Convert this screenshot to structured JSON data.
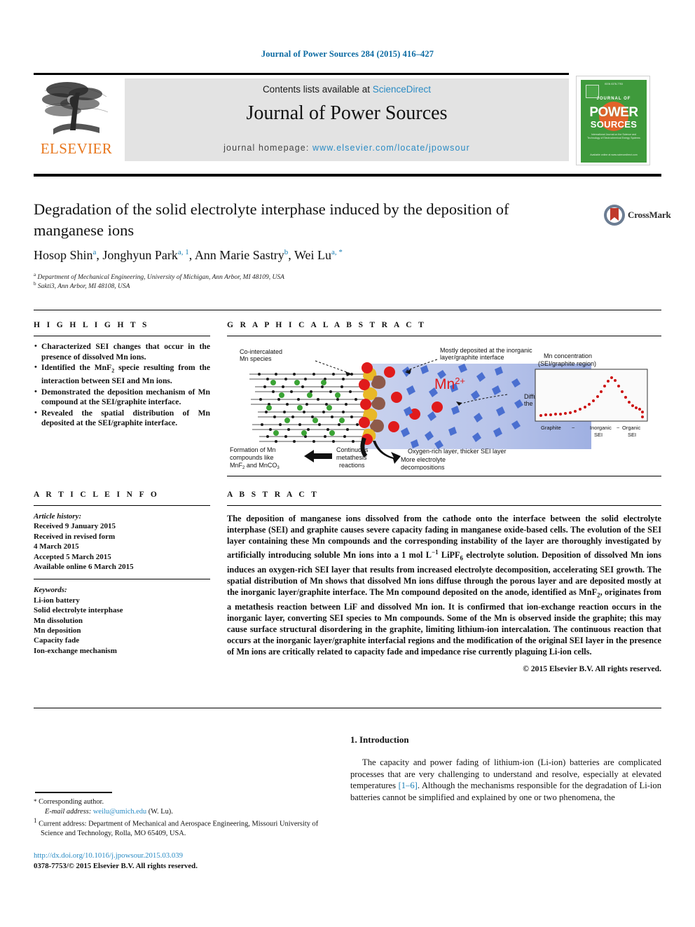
{
  "running_head": "Journal of Power Sources 284 (2015) 416–427",
  "masthead": {
    "contents_prefix": "Contents lists available at ",
    "sciencedirect": "ScienceDirect",
    "journal_title": "Journal of Power Sources",
    "homepage_prefix": "journal homepage: ",
    "homepage_url": "www.elsevier.com/locate/jpowsour",
    "publisher": "ELSEVIER",
    "cover": {
      "top_text": "ISSN 0378-7753",
      "journal_word": "JOURNAL OF",
      "power": "POWER",
      "sources": "SOURCES",
      "blurb": "International Journal on the Science and Technology of Electrochemical Energy Systems",
      "foot": "Available online at www.sciencedirect.com"
    },
    "accent_blue": "#2a8bc4",
    "elsevier_orange": "#e8761c",
    "cover_green": "#3f9a3c"
  },
  "crossmark": {
    "label": "CrossMark"
  },
  "article": {
    "title": "Degradation of the solid electrolyte interphase induced by the deposition of manganese ions",
    "authors": [
      {
        "name": "Hosop Shin",
        "marks": "a"
      },
      {
        "name": "Jonghyun Park",
        "marks": "a, 1"
      },
      {
        "name": "Ann Marie Sastry",
        "marks": "b"
      },
      {
        "name": "Wei Lu",
        "marks": "a, *"
      }
    ],
    "affiliations": [
      {
        "mark": "a",
        "text": "Department of Mechanical Engineering, University of Michigan, Ann Arbor, MI 48109, USA"
      },
      {
        "mark": "b",
        "text": "Sakti3, Ann Arbor, MI 48108, USA"
      }
    ]
  },
  "highlights": {
    "heading": "H I G H L I G H T S",
    "items": [
      "Characterized SEI changes that occur in the presence of dissolved Mn ions.",
      "Identified the MnF2 specie resulting from the interaction between SEI and Mn ions.",
      "Demonstrated the deposition mechanism of Mn compound at the SEI/graphite interface.",
      "Revealed the spatial distribution of Mn deposited at the SEI/graphite interface."
    ]
  },
  "graphical_abstract": {
    "heading": "G R A P H I C A L   A B S T R A C T",
    "labels": {
      "co_intercalated": "Co-intercalated\nMn species",
      "mostly_deposited": "Mostly deposited at the inorganic\nlayer/graphite interface",
      "mn_ion": "Mn",
      "mn_ion_charge": "2+",
      "diffuse": "Diffuse through\nthe porous layer",
      "formation": "Formation of Mn\ncompounds like\nMnF2 and MnCO3",
      "continuous": "Continuous\nmetathesis\nreactions",
      "oxygen_rich": "Oxygen-rich layer, thicker SEI layer",
      "more_electrolyte": "More electrolyte\ndecompositions"
    },
    "inset": {
      "title_line1": "Mn concentration",
      "title_line2": "(SEI/graphite region)",
      "axis_labels": [
        "Graphite",
        "~",
        "Inorganic",
        "SEI",
        "~",
        "Organic",
        "SEI"
      ]
    }
  },
  "article_info": {
    "heading": "A R T I C L E   I N F O",
    "history_label": "Article history:",
    "history": [
      "Received 9 January 2015",
      "Received in revised form",
      "4 March 2015",
      "Accepted 5 March 2015",
      "Available online 6 March 2015"
    ],
    "keywords_label": "Keywords:",
    "keywords": [
      "Li-ion battery",
      "Solid electrolyte interphase",
      "Mn dissolution",
      "Mn deposition",
      "Capacity fade",
      "Ion-exchange mechanism"
    ]
  },
  "abstract": {
    "heading": "A B S T R A C T",
    "paragraph_part1": "The deposition of manganese ions dissolved from the cathode onto the interface between the solid electrolyte interphase (SEI) and graphite causes severe capacity fading in manganese oxide-based cells. The evolution of the SEI layer containing these Mn compounds and the corresponding instability of the layer are thoroughly investigated by artificially introducing soluble Mn ions into a 1 mol L",
    "sup1": "−1",
    "paragraph_part2": " LiPF",
    "sub1": "6",
    "paragraph_part3": " electrolyte solution. Deposition of dissolved Mn ions induces an oxygen-rich SEI layer that results from increased electrolyte decomposition, accelerating SEI growth. The spatial distribution of Mn shows that dissolved Mn ions diffuse through the porous layer and are deposited mostly at the inorganic layer/graphite interface. The Mn compound deposited on the anode, identified as MnF",
    "sub2": "2",
    "paragraph_part4": ", originates from a metathesis reaction between LiF and dissolved Mn ion. It is confirmed that ion-exchange reaction occurs in the inorganic layer, converting SEI species to Mn compounds. Some of the Mn is observed inside the graphite; this may cause surface structural disordering in the graphite, limiting lithium-ion intercalation. The continuous reaction that occurs at the inorganic layer/graphite interfacial regions and the modification of the original SEI layer in the presence of Mn ions are critically related to capacity fade and impedance rise currently plaguing Li-ion cells.",
    "copyright": "© 2015 Elsevier B.V. All rights reserved."
  },
  "introduction": {
    "heading": "1.  Introduction",
    "body_part1": "The capacity and power fading of lithium-ion (Li-ion) batteries are complicated processes that are very challenging to understand and resolve, especially at elevated temperatures ",
    "citation": "[1–6]",
    "body_part2": ". Although the mechanisms responsible for the degradation of Li-ion batteries cannot be simplified and explained by one or two phenomena, the"
  },
  "footnotes": {
    "corresponding_mark": "*",
    "corresponding_text": "Corresponding author.",
    "email_label": "E-mail address:",
    "email": "weilu@umich.edu",
    "email_suffix": "(W. Lu).",
    "note1_mark": "1",
    "note1_text": "Current address: Department of Mechanical and Aerospace Engineering, Missouri University of Science and Technology, Rolla, MO 65409, USA."
  },
  "footer": {
    "doi": "http://dx.doi.org/10.1016/j.jpowsour.2015.03.039",
    "issn_line": "0378-7753/© 2015 Elsevier B.V. All rights reserved."
  }
}
